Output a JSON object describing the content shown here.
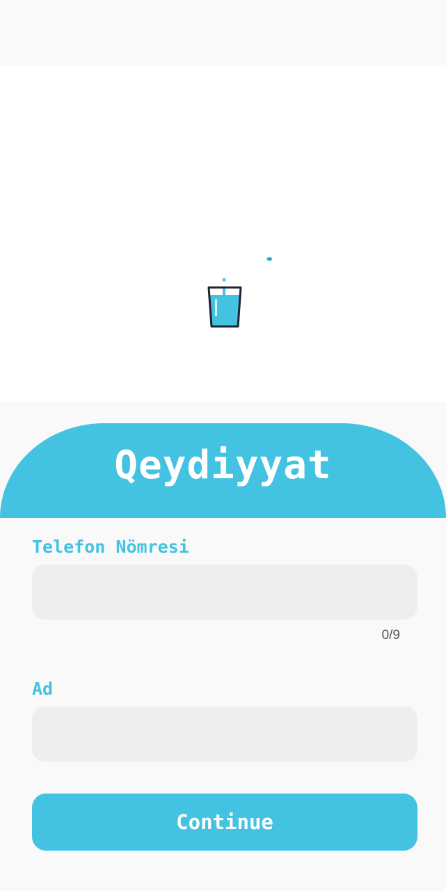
{
  "title": "Qeydiyyat",
  "phone": {
    "label": "Telefon Nömresi",
    "value": "",
    "counter": "0/9"
  },
  "name": {
    "label": "Ad",
    "value": ""
  },
  "continue_label": "Continue",
  "colors": {
    "accent": "#43c2e1",
    "input_bg": "#eeeeee",
    "background": "#f9f9f9"
  },
  "icons": {
    "hero": "water-glass-icon"
  }
}
